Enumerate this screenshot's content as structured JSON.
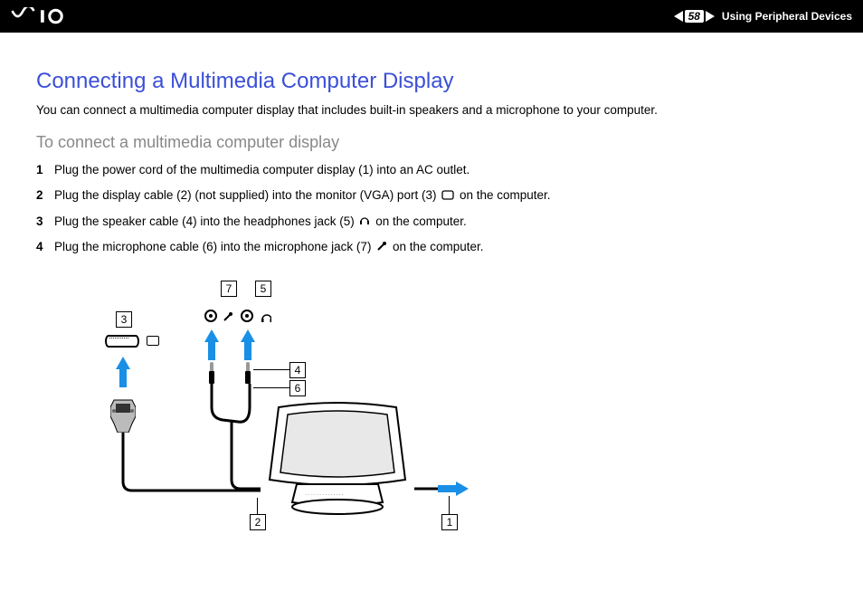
{
  "header": {
    "page_number": "58",
    "section": "Using Peripheral Devices"
  },
  "content": {
    "title": "Connecting a Multimedia Computer Display",
    "intro": "You can connect a multimedia computer display that includes built-in speakers and a microphone to your computer.",
    "subheading": "To connect a multimedia computer display",
    "steps": [
      {
        "n": "1",
        "text": "Plug the power cord of the multimedia computer display (1) into an AC outlet."
      },
      {
        "n": "2",
        "text_a": "Plug the display cable (2) (not supplied) into the monitor (VGA) port (3) ",
        "text_b": " on the computer."
      },
      {
        "n": "3",
        "text_a": "Plug the speaker cable (4) into the headphones jack (5) ",
        "text_b": " on the computer."
      },
      {
        "n": "4",
        "text_a": "Plug the microphone cable (6) into the microphone jack (7) ",
        "text_b": " on the computer."
      }
    ]
  },
  "diagram": {
    "callouts": {
      "c1": "1",
      "c2": "2",
      "c3": "3",
      "c4": "4",
      "c5": "5",
      "c6": "6",
      "c7": "7"
    }
  }
}
